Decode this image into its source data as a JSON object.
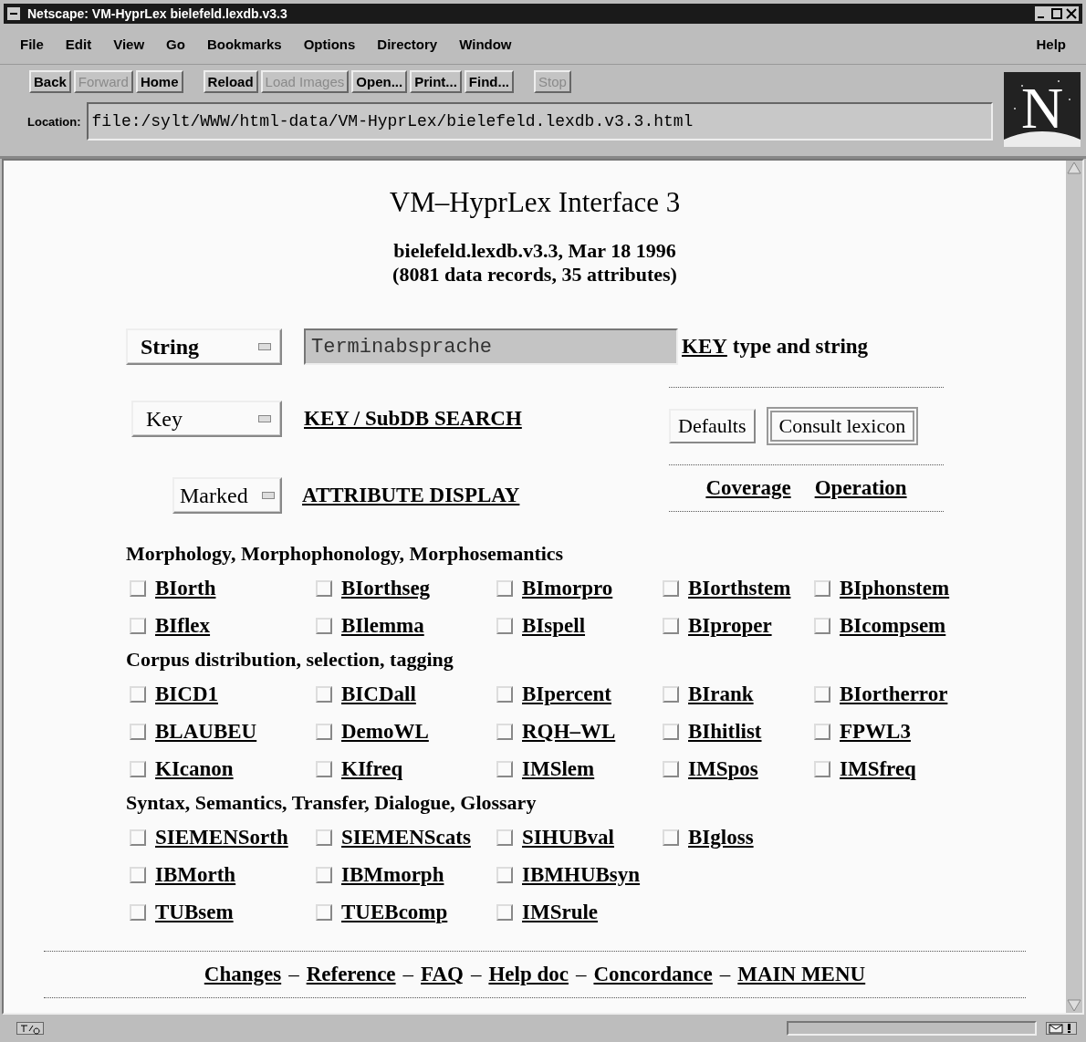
{
  "window": {
    "title": "Netscape: VM-HyprLex bielefeld.lexdb.v3.3"
  },
  "menu": {
    "items": [
      "File",
      "Edit",
      "View",
      "Go",
      "Bookmarks",
      "Options",
      "Directory",
      "Window"
    ],
    "help": "Help"
  },
  "toolbar": [
    [
      {
        "label": "Back",
        "disabled": false
      },
      {
        "label": "Forward",
        "disabled": true
      },
      {
        "label": "Home",
        "disabled": false
      }
    ],
    [
      {
        "label": "Reload",
        "disabled": false
      },
      {
        "label": "Load Images",
        "disabled": true
      },
      {
        "label": "Open...",
        "disabled": false
      },
      {
        "label": "Print...",
        "disabled": false
      },
      {
        "label": "Find...",
        "disabled": false
      }
    ],
    [
      {
        "label": "Stop",
        "disabled": true
      }
    ]
  ],
  "location": {
    "label": "Location:",
    "value": "file:/sylt/WWW/html-data/VM-HyprLex/bielefeld.lexdb.v3.3.html"
  },
  "logo": {
    "letter": "N"
  },
  "page": {
    "title": "VM–HyprLex Interface 3",
    "subtitle": [
      "bielefeld.lexdb.v3.3, Mar 18 1996",
      "(8081 data records, 35 attributes)"
    ],
    "key_type": {
      "value": "String"
    },
    "search_field": {
      "value": "Terminabsprache"
    },
    "key_label": {
      "link": "KEY",
      "text": "type and string"
    },
    "search_mode": {
      "value": "Key"
    },
    "search_link": "KEY / SubDB SEARCH",
    "display_mode": {
      "value": "Marked"
    },
    "display_link": "ATTRIBUTE DISPLAY",
    "buttons": [
      {
        "label": "Defaults",
        "default": false
      },
      {
        "label": "Consult lexicon",
        "default": true
      }
    ],
    "info_links": [
      "Coverage",
      "Operation"
    ],
    "sections": [
      {
        "heading": "Morphology, Morphophonology, Morphosemantics",
        "rows": [
          [
            {
              "label": "BIorth",
              "checked": false
            },
            {
              "label": "BIorthseg",
              "checked": false
            },
            {
              "label": "BImorpro",
              "checked": false
            },
            {
              "label": "BIorthstem",
              "checked": false
            },
            {
              "label": "BIphonstem",
              "checked": false
            }
          ],
          [
            {
              "label": "BIflex",
              "checked": false
            },
            {
              "label": "BIlemma",
              "checked": false
            },
            {
              "label": "BIspell",
              "checked": false
            },
            {
              "label": "BIproper",
              "checked": false
            },
            {
              "label": "BIcompsem",
              "checked": false
            }
          ]
        ]
      },
      {
        "heading": "Corpus distribution, selection, tagging",
        "rows": [
          [
            {
              "label": "BICD1",
              "checked": false
            },
            {
              "label": "BICDall",
              "checked": false
            },
            {
              "label": "BIpercent",
              "checked": false
            },
            {
              "label": "BIrank",
              "checked": false
            },
            {
              "label": "BIortherror",
              "checked": false
            }
          ],
          [
            {
              "label": "BLAUBEU",
              "checked": false
            },
            {
              "label": "DemoWL",
              "checked": false
            },
            {
              "label": "RQH–WL",
              "checked": false
            },
            {
              "label": "BIhitlist",
              "checked": false
            },
            {
              "label": "FPWL3",
              "checked": false
            }
          ],
          [
            {
              "label": "KIcanon",
              "checked": false
            },
            {
              "label": "KIfreq",
              "checked": false
            },
            {
              "label": "IMSlem",
              "checked": false
            },
            {
              "label": "IMSpos",
              "checked": false
            },
            {
              "label": "IMSfreq",
              "checked": false
            }
          ]
        ]
      },
      {
        "heading": "Syntax, Semantics, Transfer, Dialogue, Glossary",
        "rows": [
          [
            {
              "label": "SIEMENSorth",
              "checked": false
            },
            {
              "label": "SIEMENScats",
              "checked": false
            },
            {
              "label": "SIHUBval",
              "checked": false
            },
            {
              "label": "BIgloss",
              "checked": false
            }
          ],
          [
            {
              "label": "IBMorth",
              "checked": false
            },
            {
              "label": "IBMmorph",
              "checked": false
            },
            {
              "label": "IBMHUBsyn",
              "checked": false
            }
          ],
          [
            {
              "label": "TUBsem",
              "checked": false
            },
            {
              "label": "TUEBcomp",
              "checked": false
            },
            {
              "label": "IMSrule",
              "checked": false
            }
          ]
        ]
      }
    ],
    "footer": [
      {
        "kind": "link",
        "text": "Changes"
      },
      {
        "kind": "sep",
        "text": "–"
      },
      {
        "kind": "link",
        "text": "Reference"
      },
      {
        "kind": "sep",
        "text": "–"
      },
      {
        "kind": "link",
        "text": "FAQ"
      },
      {
        "kind": "sep",
        "text": "–"
      },
      {
        "kind": "link",
        "text": "Help doc"
      },
      {
        "kind": "sep",
        "text": "–"
      },
      {
        "kind": "link",
        "text": "Concordance"
      },
      {
        "kind": "sep",
        "text": "–"
      },
      {
        "kind": "link",
        "text": "MAIN MENU"
      }
    ]
  }
}
